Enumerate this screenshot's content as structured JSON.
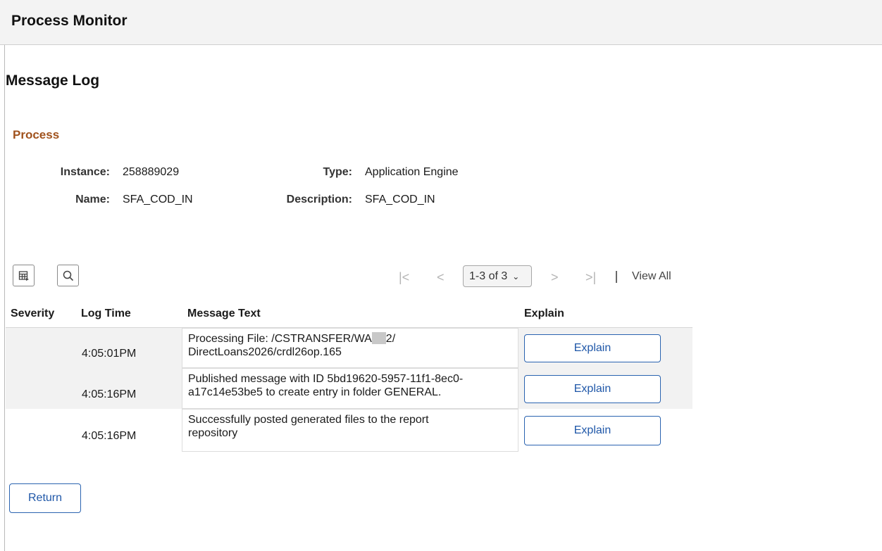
{
  "header": {
    "title": "Process Monitor"
  },
  "page": {
    "title": "Message Log"
  },
  "process": {
    "section_title": "Process",
    "instance_label": "Instance:",
    "instance_value": "258889029",
    "type_label": "Type:",
    "type_value": "Application Engine",
    "name_label": "Name:",
    "name_value": "SFA_COD_IN",
    "description_label": "Description:",
    "description_value": "SFA_COD_IN"
  },
  "toolbar": {
    "icons": [
      "personalize-grid-icon",
      "search-icon"
    ]
  },
  "pager": {
    "range": "1-3 of 3",
    "view_all": "View All",
    "icons": [
      "first-page-icon",
      "previous-page-icon",
      "next-page-icon",
      "last-page-icon"
    ]
  },
  "table": {
    "columns": [
      "Severity",
      "Log Time",
      "Message Text",
      "Explain"
    ],
    "rows": [
      {
        "severity": "",
        "time": "4:05:01PM",
        "message_line1_a": "Processing File: /CSTRANSFER/WA",
        "message_line1_b": "2/",
        "message_line2": "DirectLoans2026/crdl26op.165",
        "explain": "Explain"
      },
      {
        "severity": "",
        "time": "4:05:16PM",
        "message_line1": "Published message with ID 5bd19620-5957-11f1-8ec0-",
        "message_line2": "a17c14e53be5 to create entry in folder GENERAL.",
        "explain": "Explain"
      },
      {
        "severity": "",
        "time": "4:05:16PM",
        "message_line1": "Successfully posted generated files to the report",
        "message_line2": "repository",
        "explain": "Explain"
      }
    ]
  },
  "footer": {
    "return_label": "Return"
  },
  "colors": {
    "section_title": "#a0521d",
    "button_border": "#2a63b0",
    "row_shaded": "#f2f2f2"
  }
}
